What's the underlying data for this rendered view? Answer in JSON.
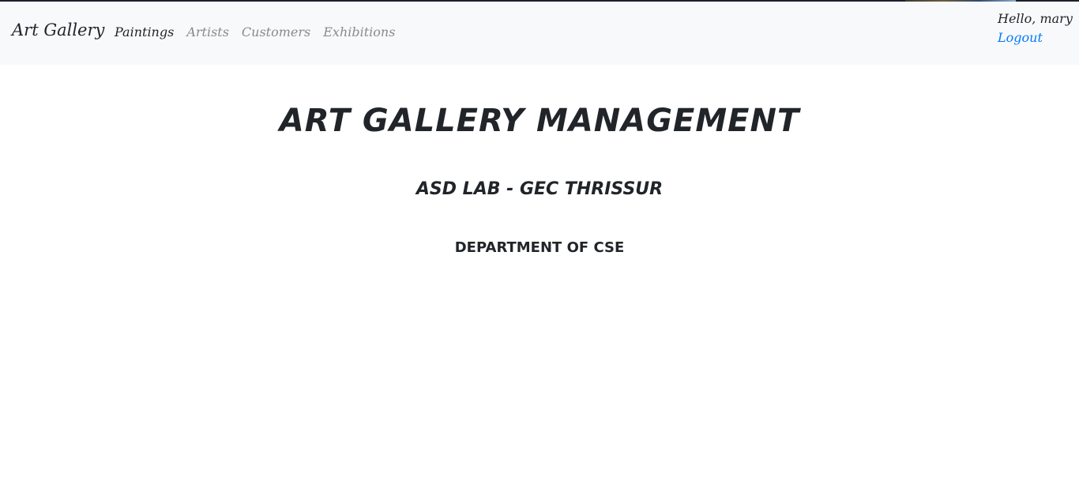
{
  "navbar": {
    "brand": "Art Gallery",
    "links": [
      {
        "label": "Paintings",
        "active": true
      },
      {
        "label": "Artists",
        "active": false
      },
      {
        "label": "Customers",
        "active": false
      },
      {
        "label": "Exhibitions",
        "active": false
      }
    ],
    "greeting": "Hello, mary",
    "logout": "Logout"
  },
  "main": {
    "title": "Art Gallery Management",
    "subtitle": "ASD LAB - GEC THRISSUR",
    "department": "Department of CSE"
  },
  "colors": {
    "navbar_bg": "#f8f9fa",
    "link_active": "#212529",
    "link_inactive": "#8a8a8a",
    "logout_link": "#007bff",
    "text": "#212529"
  }
}
